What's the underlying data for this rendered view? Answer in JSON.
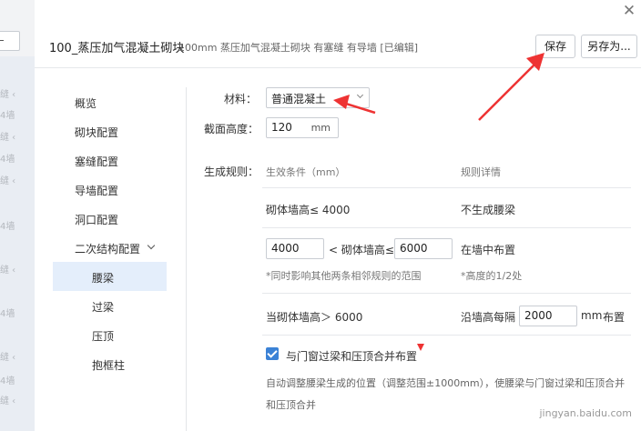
{
  "background": {
    "fragments": [
      "缝 ‹",
      "4墙",
      "缝 ‹",
      "4墙",
      "缝 ‹",
      "4墙",
      "缝 ‹",
      "4墙",
      "缝 ‹",
      "4墙",
      "缝 ‹"
    ]
  },
  "dialog": {
    "title": "100_蒸压加气混凝土砌块",
    "subtitle": "100mm 蒸压加气混凝土砌块 有塞缝 有导墙 [已编辑]",
    "save_label": "保存",
    "save_as_label": "另存为..."
  },
  "nav": {
    "items": [
      "概览",
      "砌块配置",
      "塞缝配置",
      "导墙配置",
      "洞口配置",
      "二次结构配置"
    ],
    "sub_items": [
      "腰梁",
      "过梁",
      "压顶",
      "抱框柱"
    ],
    "active": "腰梁"
  },
  "form": {
    "material_label": "材料：",
    "material_value": "普通混凝土",
    "section_height_label": "截面高度：",
    "section_height_value": "120",
    "section_height_unit": "mm",
    "rules_label": "生成规则：",
    "col_condition": "生效条件（mm）",
    "col_detail": "规则详情",
    "rule1_condition": "砌体墙高≤ 4000",
    "rule1_detail": "不生成腰梁",
    "rule2_min": "4000",
    "rule2_mid": "< 砌体墙高≤",
    "rule2_max": "6000",
    "rule2_detail": "在墙中布置",
    "rule2_note": "*同时影响其他两条相邻规则的范围",
    "rule2_detail_note": "*高度的1/2处",
    "rule3_condition": "当砌体墙高＞ 6000",
    "rule3_detail_prefix": "沿墙高每隔",
    "rule3_value": "2000",
    "rule3_unit": "mm",
    "rule3_suffix": "布置",
    "checkbox_label": "与门窗过梁和压顶合并布置",
    "checkbox_checked": true,
    "description": "自动调整腰梁生成的位置（调整范围±1000mm），使腰梁与门窗过梁和压顶合并和压顶合并"
  },
  "watermark": "jingyan.baidu.com",
  "colors": {
    "accent": "#3b82d6",
    "active_nav_bg": "#e4eefb",
    "annotation_red": "#ee3333"
  }
}
